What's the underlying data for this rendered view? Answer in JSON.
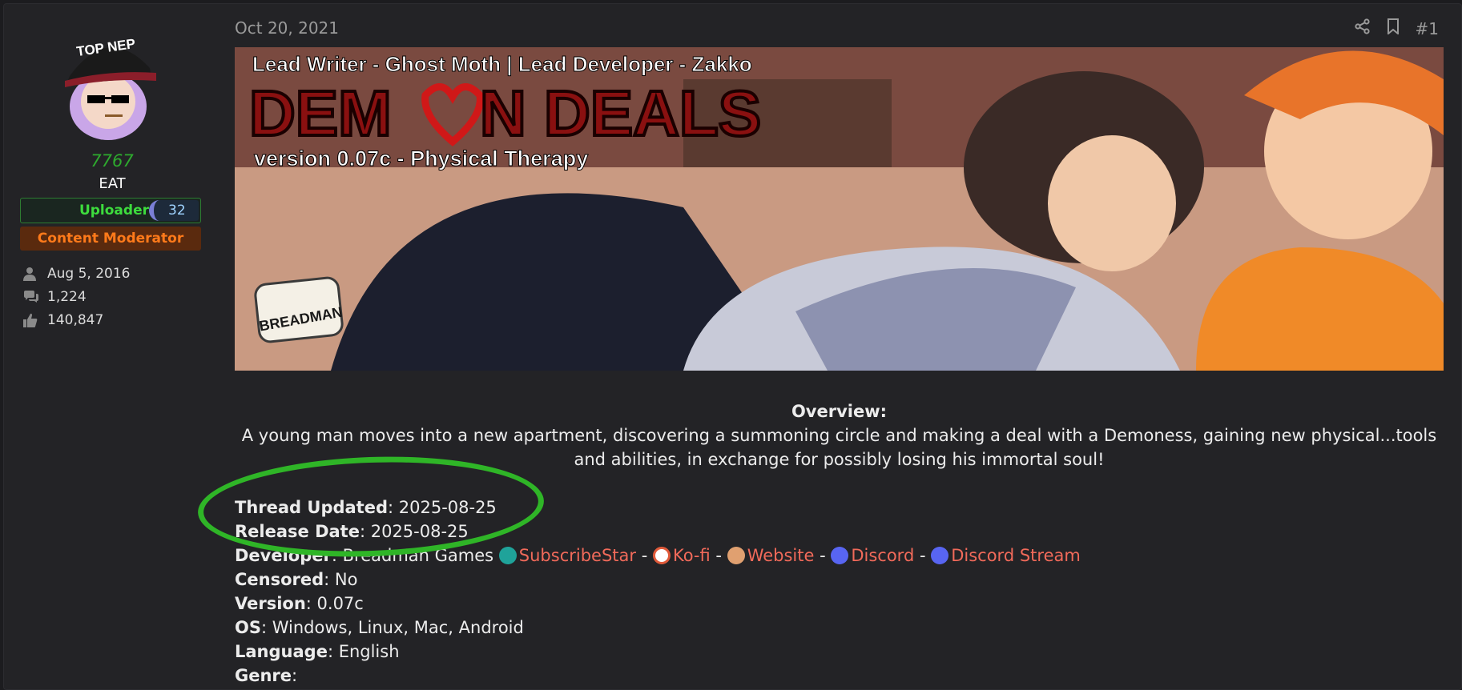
{
  "post": {
    "date": "Oct 20, 2021",
    "number": "#1"
  },
  "user": {
    "avatar_caption": "TOP NEP",
    "score": "7767",
    "title": "EAT",
    "banner_uploader": "Uploader",
    "banner_uploader_badge": "32",
    "banner_moderator": "Content Moderator",
    "joined": "Aug 5, 2016",
    "messages": "1,224",
    "reactions": "140,847"
  },
  "banner": {
    "credits": "Lead Writer - Ghost Moth  |  Lead Developer - Zakko",
    "title_left": "DEM",
    "title_right": "N DEALS",
    "version_line": "version 0.07c - Physical Therapy",
    "logo_text": "BREADMAN"
  },
  "overview": {
    "heading": "Overview:",
    "text": "A young man moves into a new apartment, discovering a summoning circle and making a deal with a Demoness, gaining new physical...tools and abilities, in exchange for possibly losing his immortal soul!"
  },
  "fields": {
    "thread_updated": {
      "label": "Thread Updated",
      "value": ": 2025-08-25"
    },
    "release_date": {
      "label": "Release Date",
      "value": ": 2025-08-25"
    },
    "developer": {
      "label": "Developer",
      "value": ": Breadman Games "
    },
    "censored": {
      "label": "Censored",
      "value": ": No"
    },
    "version": {
      "label": "Version",
      "value": ": 0.07c"
    },
    "os": {
      "label": "OS",
      "value": ": Windows, Linux, Mac, Android"
    },
    "language": {
      "label": "Language",
      "value": ": English"
    },
    "genre": {
      "label": "Genre",
      "value": ":"
    }
  },
  "dev_links": {
    "subscribestar": "SubscribeStar",
    "kofi": "Ko-fi",
    "website": "Website",
    "discord": "Discord",
    "discord_stream": "Discord Stream",
    "sep": " - "
  },
  "colors": {
    "link": "#f16a5a",
    "uploader_green": "#3ddc3d",
    "moderator_orange": "#ff7a1a",
    "highlight_green": "#2fb527"
  }
}
